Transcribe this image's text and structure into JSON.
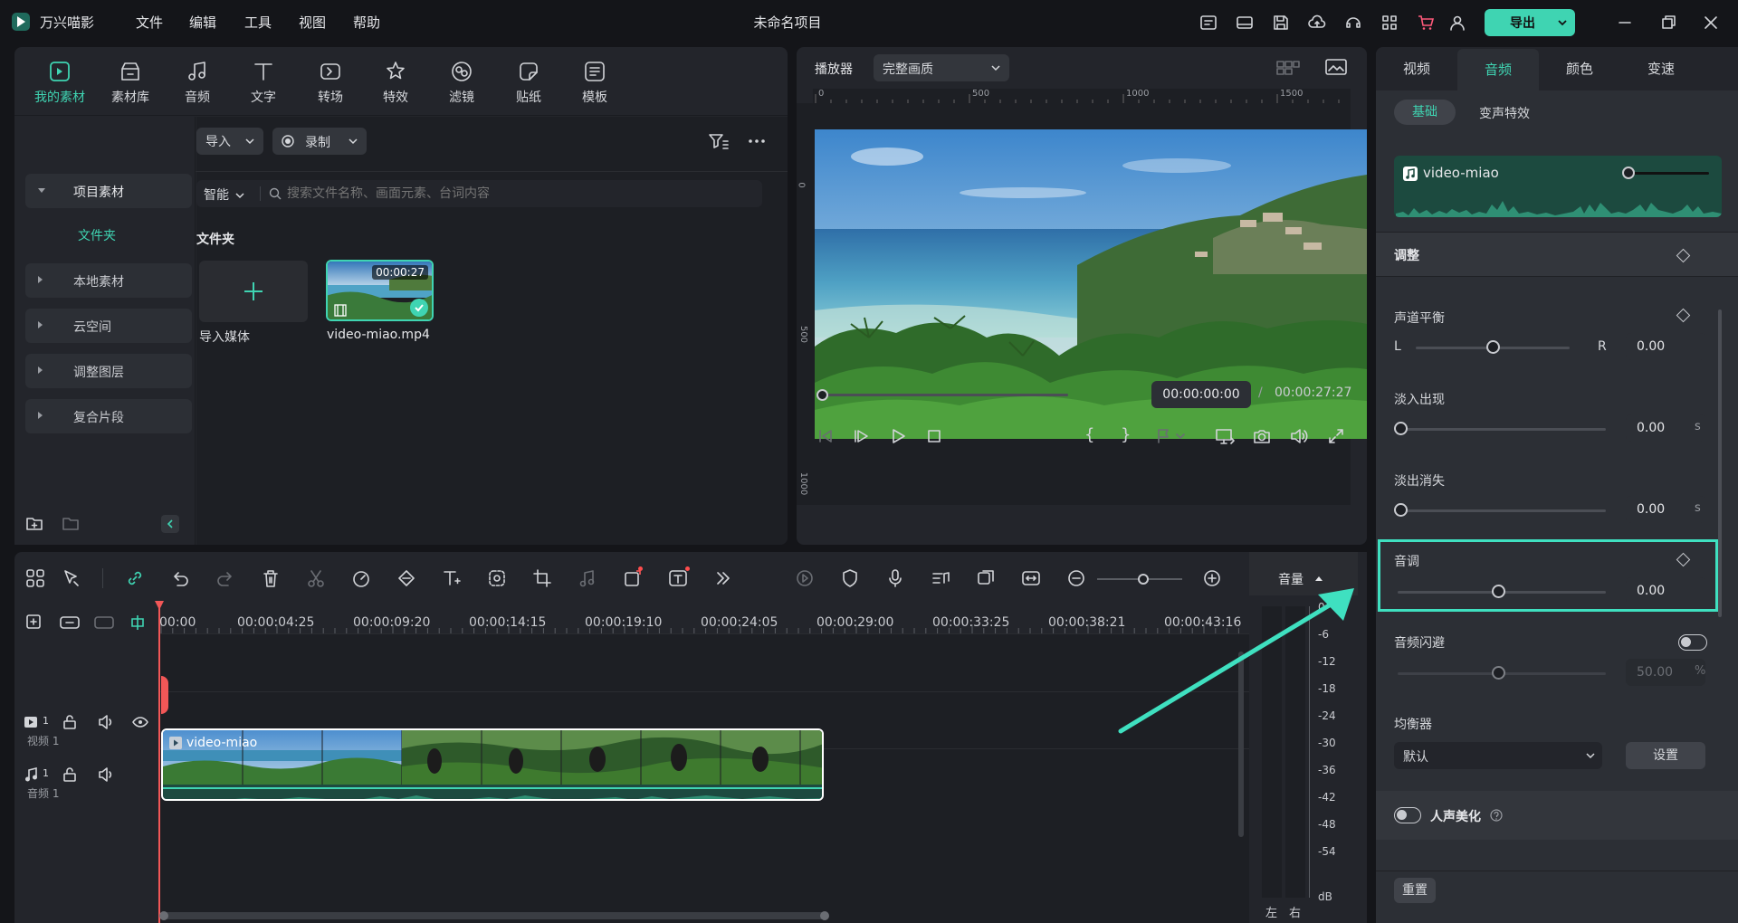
{
  "app": {
    "name": "万兴喵影",
    "project_title": "未命名项目",
    "export_label": "导出"
  },
  "menu": [
    "文件",
    "编辑",
    "工具",
    "视图",
    "帮助"
  ],
  "toolbar": [
    {
      "label": "我的素材",
      "icon": "my-media-icon"
    },
    {
      "label": "素材库",
      "icon": "library-icon"
    },
    {
      "label": "音频",
      "icon": "audio-icon"
    },
    {
      "label": "文字",
      "icon": "text-icon"
    },
    {
      "label": "转场",
      "icon": "transition-icon"
    },
    {
      "label": "特效",
      "icon": "effects-icon"
    },
    {
      "label": "滤镜",
      "icon": "filter-icon"
    },
    {
      "label": "贴纸",
      "icon": "sticker-icon"
    },
    {
      "label": "模板",
      "icon": "template-icon"
    }
  ],
  "sidebar": {
    "project_media": "项目素材",
    "folder": "文件夹",
    "items": [
      "本地素材",
      "云空间",
      "调整图层",
      "复合片段"
    ]
  },
  "media": {
    "import": "导入",
    "record": "录制",
    "smart": "智能",
    "search_placeholder": "搜索文件名称、画面元素、台词内容",
    "section_title": "文件夹",
    "import_media": "导入媒体",
    "clip_name": "video-miao.mp4",
    "clip_duration": "00:00:27"
  },
  "player": {
    "label": "播放器",
    "quality": "完整画质",
    "ruler_top": [
      "0",
      "500",
      "1000",
      "1500"
    ],
    "ruler_left": [
      "0",
      "500",
      "1000"
    ],
    "current_time": "00:00:00:00",
    "separator": "/",
    "total_time": "00:00:27:27",
    "progress": 0
  },
  "inspector": {
    "tabs": [
      "视频",
      "音频",
      "颜色",
      "变速"
    ],
    "active_tab": "音频",
    "subtabs": [
      "基础",
      "变声特效"
    ],
    "track_name": "video-miao",
    "adjust_section": "调整",
    "balance": {
      "label": "声道平衡",
      "left": "L",
      "right": "R",
      "value": "0.00",
      "level": 0.5
    },
    "fade_in": {
      "label": "淡入出现",
      "value": "0.00",
      "unit": "s",
      "level": 0
    },
    "fade_out": {
      "label": "淡出消失",
      "value": "0.00",
      "unit": "s",
      "level": 0
    },
    "pitch": {
      "label": "音调",
      "value": "0.00",
      "level": 0.5
    },
    "ducking": {
      "label": "音频闪避",
      "value": "50.00",
      "unit": "%",
      "level": 0.5
    },
    "equalizer": {
      "label": "均衡器",
      "preset": "默认",
      "settings_label": "设置"
    },
    "voice_enhance": "人声美化",
    "reset": "重置"
  },
  "timeline": {
    "volume_label": "音量",
    "ruler": [
      "00:00",
      "00:00:04:25",
      "00:00:09:20",
      "00:00:14:15",
      "00:00:19:10",
      "00:00:24:05",
      "00:00:29:00",
      "00:00:33:25",
      "00:00:38:21",
      "00:00:43:16"
    ],
    "video_track": {
      "num": "1",
      "name": "视频 1"
    },
    "audio_track": {
      "num": "1",
      "name": "音频 1"
    },
    "clip_label": "video-miao",
    "meter_db": [
      "0",
      "-6",
      "-12",
      "-18",
      "-24",
      "-30",
      "-36",
      "-42",
      "-48",
      "-54",
      "dB"
    ],
    "meter_left": "左",
    "meter_right": "右"
  },
  "colors": {
    "accent": "#3fd4b2",
    "highlight": "#3fe0c0",
    "playhead": "#f25757"
  }
}
